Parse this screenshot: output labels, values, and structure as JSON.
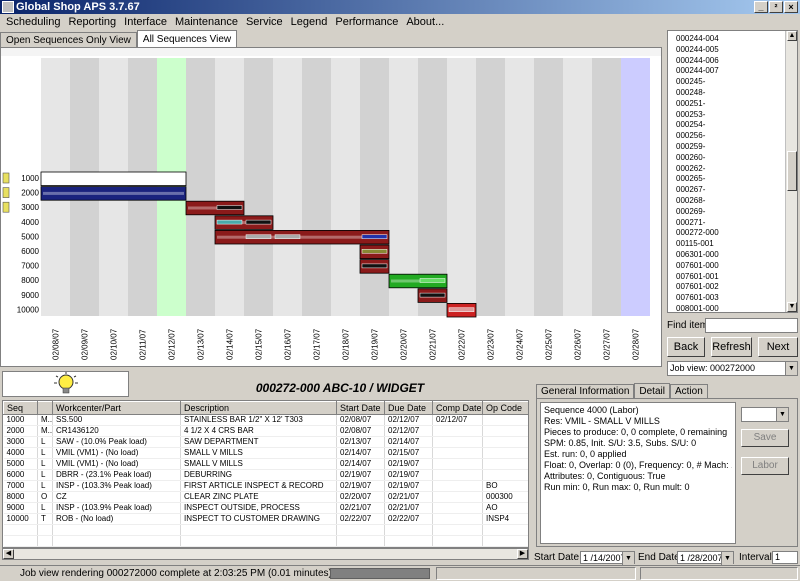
{
  "window": {
    "title": "Global Shop APS 3.7.67",
    "min": "_",
    "restore": "²",
    "close": "×"
  },
  "menu": [
    "Scheduling",
    "Reporting",
    "Interface",
    "Maintenance",
    "Service",
    "Legend",
    "Performance",
    "About..."
  ],
  "tabs": [
    {
      "label": "Open Sequences Only View",
      "active": false
    },
    {
      "label": "All Sequences View",
      "active": true
    }
  ],
  "chart_data": {
    "type": "gantt",
    "x_dates": [
      "02/08/07",
      "02/09/07",
      "02/10/07",
      "02/11/07",
      "02/12/07",
      "02/13/07",
      "02/14/07",
      "02/15/07",
      "02/16/07",
      "02/17/07",
      "02/18/07",
      "02/19/07",
      "02/20/07",
      "02/21/07",
      "02/22/07",
      "02/23/07",
      "02/24/07",
      "02/25/07",
      "02/26/07",
      "02/27/07",
      "02/28/07"
    ],
    "rows": [
      "1000",
      "2000",
      "3000",
      "4000",
      "5000",
      "6000",
      "7000",
      "8000",
      "9000",
      "10000"
    ],
    "bars": [
      {
        "row": "1000",
        "start": 0,
        "end": 5,
        "color": "#ffffff"
      },
      {
        "row": "2000",
        "start": 0,
        "end": 5,
        "color": "#1a237e"
      },
      {
        "row": "3000",
        "start": 5,
        "end": 7,
        "color": "#8b1a1a"
      },
      {
        "row": "4000",
        "start": 6,
        "end": 8,
        "color": "#8b1a1a"
      },
      {
        "row": "5000",
        "start": 6,
        "end": 12,
        "color": "#8b1a1a"
      },
      {
        "row": "6000",
        "start": 11,
        "end": 12,
        "color": "#8b1a1a"
      },
      {
        "row": "7000",
        "start": 11,
        "end": 12,
        "color": "#8b1a1a"
      },
      {
        "row": "8000",
        "start": 12,
        "end": 14,
        "color": "#22aa22"
      },
      {
        "row": "9000",
        "start": 13,
        "end": 14,
        "color": "#8b1a1a"
      },
      {
        "row": "10000",
        "start": 14,
        "end": 15,
        "color": "#cc2222"
      }
    ],
    "highlight_start_index": 4,
    "highlight_end_index": 20
  },
  "jobtree": [
    "000244-004",
    "000244-005",
    "000244-006",
    "000244-007",
    "000245-",
    "000248-",
    "000251-",
    "000253-",
    "000254-",
    "000256-",
    "000259-",
    "000260-",
    "000262-",
    "000265-",
    "000267-",
    "000268-",
    "000269-",
    "000271-",
    "000272-000",
    "00115-001",
    "006301-000",
    "007601-000",
    "007601-001",
    "007601-002",
    "007601-003",
    "008001-000"
  ],
  "find_item_label": "Find item",
  "buttons": {
    "back": "Back",
    "refresh": "Refresh",
    "next": "Next"
  },
  "job_view": "Job view: 000272000",
  "job_title": "000272-000   ABC-10 / WIDGET",
  "grid": {
    "columns": [
      "Seq",
      "",
      "Workcenter/Part",
      "Description",
      "Start Date",
      "Due Date",
      "Comp Date",
      "Op Code"
    ],
    "rows": [
      [
        "1000",
        "M..",
        "SS.500",
        "STAINLESS BAR 1/2\" X 12' T303",
        "02/08/07",
        "02/12/07",
        "02/12/07",
        ""
      ],
      [
        "2000",
        "M..",
        "CR1436120",
        "4 1/2 X 4 CRS BAR",
        "02/08/07",
        "02/12/07",
        "",
        ""
      ],
      [
        "3000",
        "L",
        "SAW - (10.0% Peak load)",
        "SAW DEPARTMENT",
        "02/13/07",
        "02/14/07",
        "",
        ""
      ],
      [
        "4000",
        "L",
        "VMIL (VM1) - (No load)",
        "SMALL V MILLS",
        "02/14/07",
        "02/15/07",
        "",
        ""
      ],
      [
        "5000",
        "L",
        "VMIL (VM1) - (No load)",
        "SMALL V MILLS",
        "02/14/07",
        "02/19/07",
        "",
        ""
      ],
      [
        "6000",
        "L",
        "DBRR - (23.1% Peak load)",
        "DEBURRING",
        "02/19/07",
        "02/19/07",
        "",
        ""
      ],
      [
        "7000",
        "L",
        "INSP - (103.3% Peak load)",
        "FIRST ARTICLE INSPECT & RECORD",
        "02/19/07",
        "02/19/07",
        "",
        "BO"
      ],
      [
        "8000",
        "O",
        "CZ",
        "CLEAR ZINC PLATE",
        "02/20/07",
        "02/21/07",
        "",
        "000300"
      ],
      [
        "9000",
        "L",
        "INSP - (103.9% Peak load)",
        "INSPECT OUTSIDE, PROCESS",
        "02/21/07",
        "02/21/07",
        "",
        "AO"
      ],
      [
        "10000",
        "T",
        "ROB - (No load)",
        "INSPECT TO CUSTOMER DRAWING",
        "02/22/07",
        "02/22/07",
        "",
        "INSP4"
      ]
    ]
  },
  "detail_tabs": [
    "General Information",
    "Detail",
    "Action"
  ],
  "detail_lines": [
    "Sequence 4000    (Labor)",
    "",
    "Res: VMIL - SMALL V MILLS",
    "Pieces to produce: 0, 0 complete, 0 remaining",
    "SPM: 0.85, Init. S/U: 3.5, Subs. S/U: 0",
    "Est. run: 0, 0 applied",
    "Float: 0, Overlap: 0 (0), Frequency: 0, # Mach: 1",
    "Attributes: 0, Contiguous: True",
    "Run min: 0, Run max: 0, Run mult: 0"
  ],
  "detail_buttons": {
    "save": "Save",
    "labor": "Labor"
  },
  "dates": {
    "start_label": "Start Date",
    "start": "1 /14/2007",
    "end_label": "End Date",
    "end": "1 /28/2007",
    "interval_label": "Interval",
    "interval": "1"
  },
  "status": "Job view rendering 000272000 complete at 2:03:25 PM  (0.01 minutes)"
}
